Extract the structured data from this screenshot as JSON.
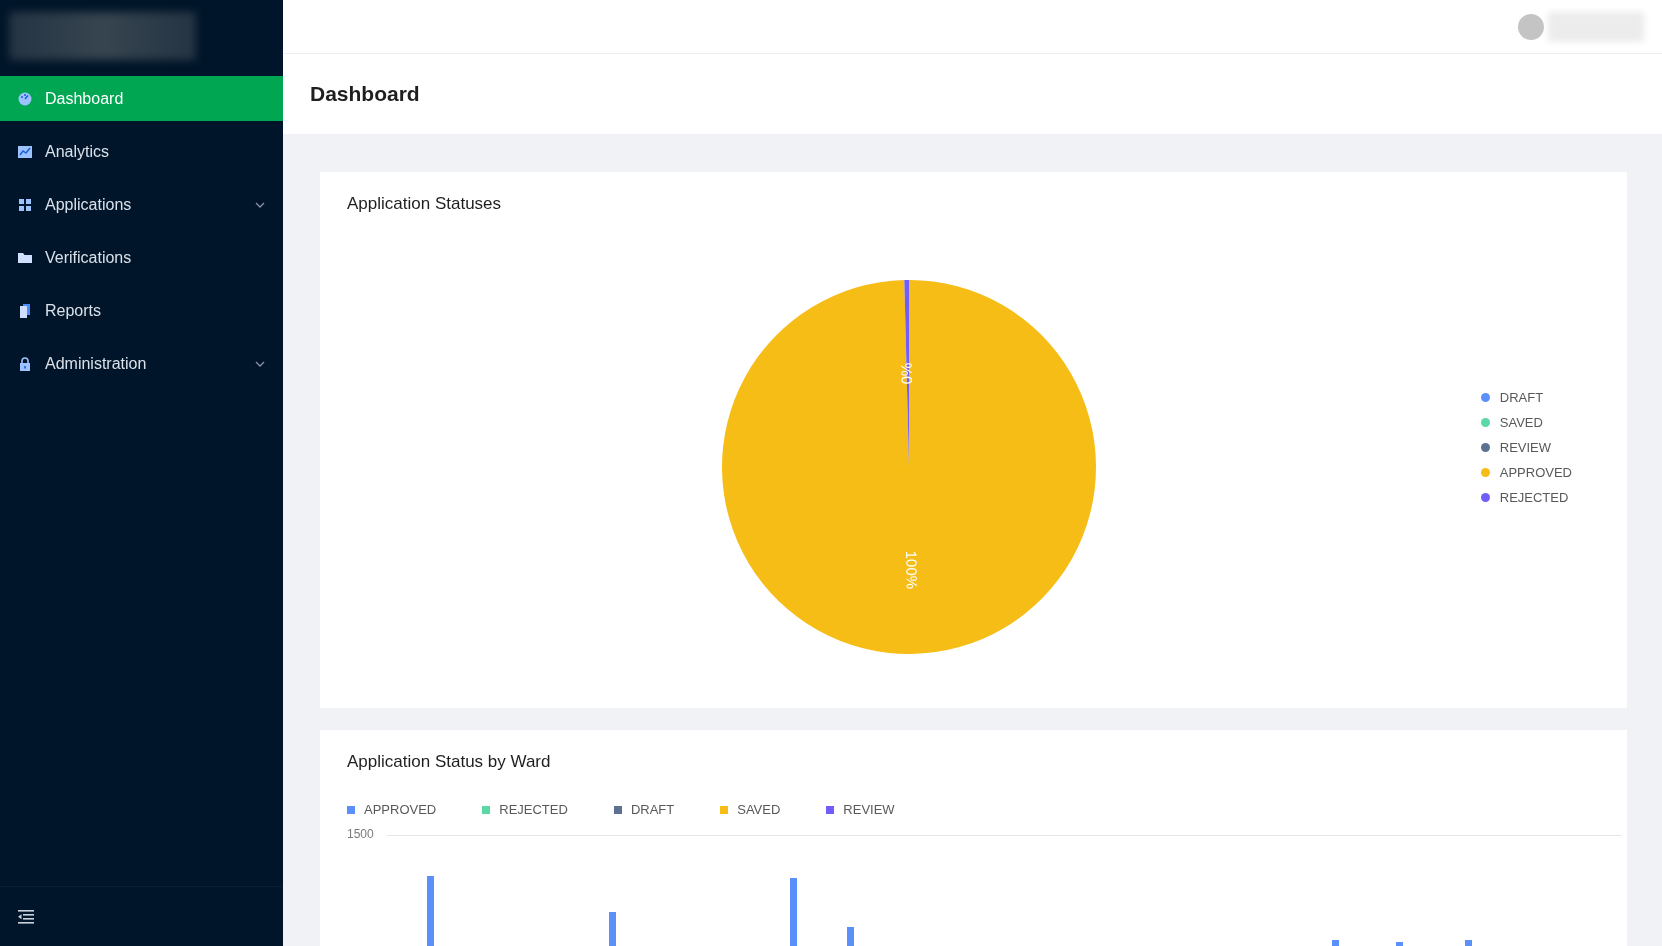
{
  "sidebar": {
    "items": [
      {
        "label": "Dashboard",
        "selected": true,
        "expandable": false
      },
      {
        "label": "Analytics",
        "selected": false,
        "expandable": false
      },
      {
        "label": "Applications",
        "selected": false,
        "expandable": true
      },
      {
        "label": "Verifications",
        "selected": false,
        "expandable": false
      },
      {
        "label": "Reports",
        "selected": false,
        "expandable": false
      },
      {
        "label": "Administration",
        "selected": false,
        "expandable": true
      }
    ]
  },
  "page": {
    "title": "Dashboard"
  },
  "status_card": {
    "title": "Application Statuses",
    "chart_data": {
      "type": "pie",
      "categories": [
        "DRAFT",
        "SAVED",
        "REVIEW",
        "APPROVED",
        "REJECTED"
      ],
      "values": [
        0,
        0,
        0,
        99.6,
        0.4
      ],
      "colors": [
        "#5b8ff9",
        "#5ad8a6",
        "#5d7092",
        "#f6bd16",
        "#6f5ef9"
      ],
      "value_labels": [
        null,
        null,
        null,
        "100%",
        "0%"
      ]
    }
  },
  "ward_card": {
    "title": "Application Status by Ward",
    "legend": [
      {
        "label": "APPROVED",
        "color": "#5b8ff9"
      },
      {
        "label": "REJECTED",
        "color": "#5ad8a6"
      },
      {
        "label": "DRAFT",
        "color": "#5d7092"
      },
      {
        "label": "SAVED",
        "color": "#f6bd16"
      },
      {
        "label": "REVIEW",
        "color": "#6f5ef9"
      }
    ],
    "y_tick": "1500"
  }
}
